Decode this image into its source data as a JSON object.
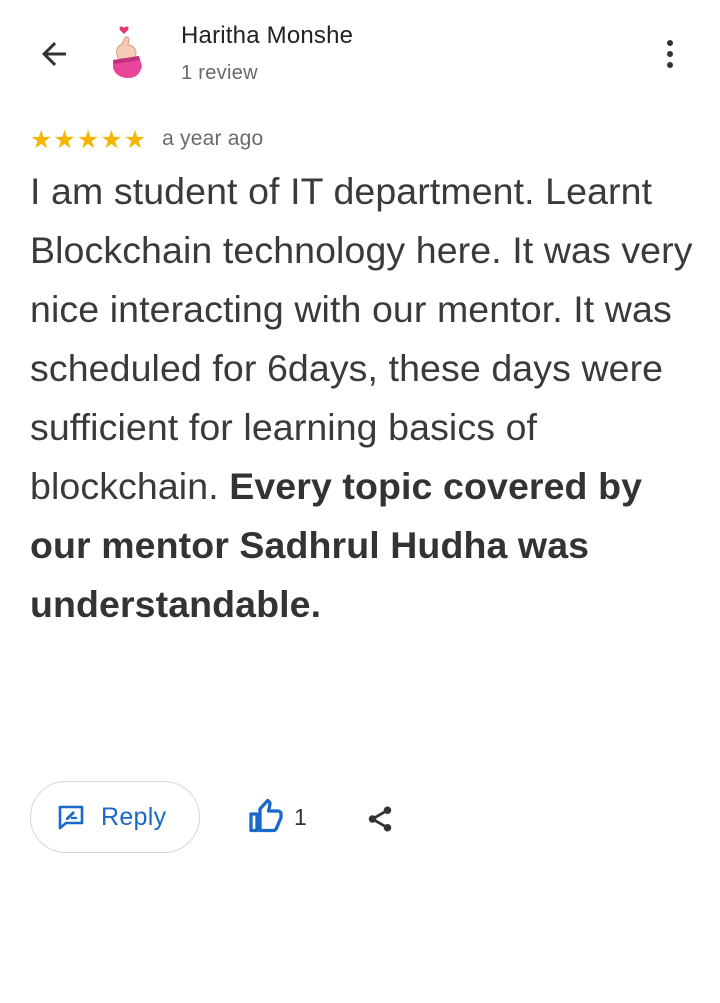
{
  "header": {
    "reviewer_name": "Haritha Monshe",
    "review_count": "1 review",
    "back_icon": "arrow-left-icon",
    "more_icon": "more-vertical-icon"
  },
  "review": {
    "rating": 5,
    "max_rating": 5,
    "star_color": "#f5b600",
    "time_ago": "a year ago",
    "text_regular": "I am student of IT department. Learnt Blockchain technology here. It was very nice interacting with our mentor. It was scheduled for 6days, these days were sufficient for learning basics of blockchain. ",
    "text_bold": "Every topic covered by our mentor Sadhrul Hudha was understandable."
  },
  "actions": {
    "reply_label": "Reply",
    "like_count": "1",
    "accent_color": "#1a68c9"
  }
}
